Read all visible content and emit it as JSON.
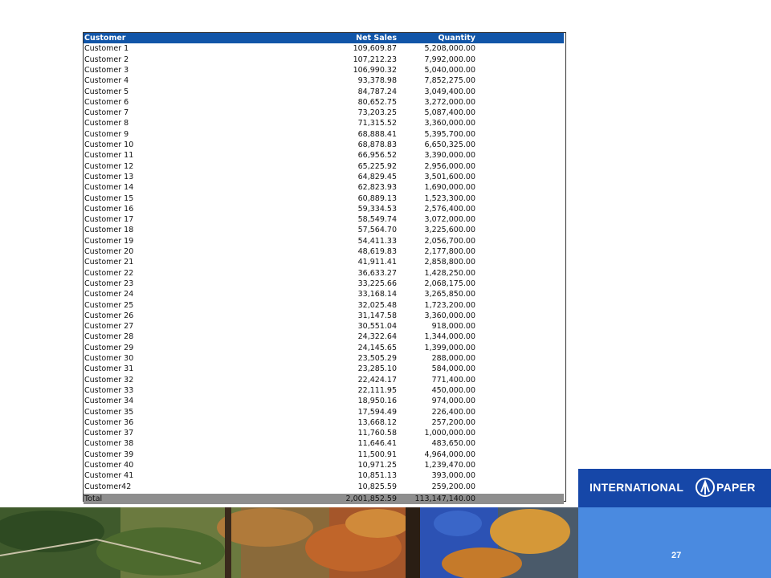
{
  "table": {
    "headers": {
      "customer": "Customer",
      "net_sales": "Net Sales",
      "quantity": "Quantity"
    },
    "rows": [
      [
        "Customer 1",
        "109,609.87",
        "5,208,000.00"
      ],
      [
        "Customer 2",
        "107,212.23",
        "7,992,000.00"
      ],
      [
        "Customer 3",
        "106,990.32",
        "5,040,000.00"
      ],
      [
        "Customer 4",
        "93,378.98",
        "7,852,275.00"
      ],
      [
        "Customer 5",
        "84,787.24",
        "3,049,400.00"
      ],
      [
        "Customer 6",
        "80,652.75",
        "3,272,000.00"
      ],
      [
        "Customer 7",
        "73,203.25",
        "5,087,400.00"
      ],
      [
        "Customer 8",
        "71,315.52",
        "3,360,000.00"
      ],
      [
        "Customer 9",
        "68,888.41",
        "5,395,700.00"
      ],
      [
        "Customer 10",
        "68,878.83",
        "6,650,325.00"
      ],
      [
        "Customer 11",
        "66,956.52",
        "3,390,000.00"
      ],
      [
        "Customer 12",
        "65,225.92",
        "2,956,000.00"
      ],
      [
        "Customer 13",
        "64,829.45",
        "3,501,600.00"
      ],
      [
        "Customer 14",
        "62,823.93",
        "1,690,000.00"
      ],
      [
        "Customer 15",
        "60,889.13",
        "1,523,300.00"
      ],
      [
        "Customer 16",
        "59,334.53",
        "2,576,400.00"
      ],
      [
        "Customer 17",
        "58,549.74",
        "3,072,000.00"
      ],
      [
        "Customer 18",
        "57,564.70",
        "3,225,600.00"
      ],
      [
        "Customer 19",
        "54,411.33",
        "2,056,700.00"
      ],
      [
        "Customer 20",
        "48,619.83",
        "2,177,800.00"
      ],
      [
        "Customer 21",
        "41,911.41",
        "2,858,800.00"
      ],
      [
        "Customer 22",
        "36,633.27",
        "1,428,250.00"
      ],
      [
        "Customer 23",
        "33,225.66",
        "2,068,175.00"
      ],
      [
        "Customer 24",
        "33,168.14",
        "3,265,850.00"
      ],
      [
        "Customer 25",
        "32,025.48",
        "1,723,200.00"
      ],
      [
        "Customer 26",
        "31,147.58",
        "3,360,000.00"
      ],
      [
        "Customer 27",
        "30,551.04",
        "918,000.00"
      ],
      [
        "Customer 28",
        "24,322.64",
        "1,344,000.00"
      ],
      [
        "Customer 29",
        "24,145.65",
        "1,399,000.00"
      ],
      [
        "Customer 30",
        "23,505.29",
        "288,000.00"
      ],
      [
        "Customer 31",
        "23,285.10",
        "584,000.00"
      ],
      [
        "Customer 32",
        "22,424.17",
        "771,400.00"
      ],
      [
        "Customer 33",
        "22,111.95",
        "450,000.00"
      ],
      [
        "Customer 34",
        "18,950.16",
        "974,000.00"
      ],
      [
        "Customer 35",
        "17,594.49",
        "226,400.00"
      ],
      [
        "Customer 36",
        "13,668.12",
        "257,200.00"
      ],
      [
        "Customer 37",
        "11,760.58",
        "1,000,000.00"
      ],
      [
        "Customer 38",
        "11,646.41",
        "483,650.00"
      ],
      [
        "Customer 39",
        "11,500.91",
        "4,964,000.00"
      ],
      [
        "Customer 40",
        "10,971.25",
        "1,239,470.00"
      ],
      [
        "Customer 41",
        "10,851.13",
        "393,000.00"
      ],
      [
        "Customer42",
        "10,825.59",
        "259,200.00"
      ]
    ],
    "total": {
      "label": "Total",
      "net_sales": "2,001,852.59",
      "quantity": "113,147,140.00"
    }
  },
  "brand": {
    "name_left": "INTERNATIONAL",
    "name_right": "PAPER",
    "logo_icon": "international-paper-logo-icon"
  },
  "slide": {
    "page_number": "27"
  },
  "colors": {
    "header_blue": "#1155a8",
    "brand_bar": "#1647a8",
    "brand_panel": "#4a8ae0",
    "total_row": "#8e8e8e"
  }
}
